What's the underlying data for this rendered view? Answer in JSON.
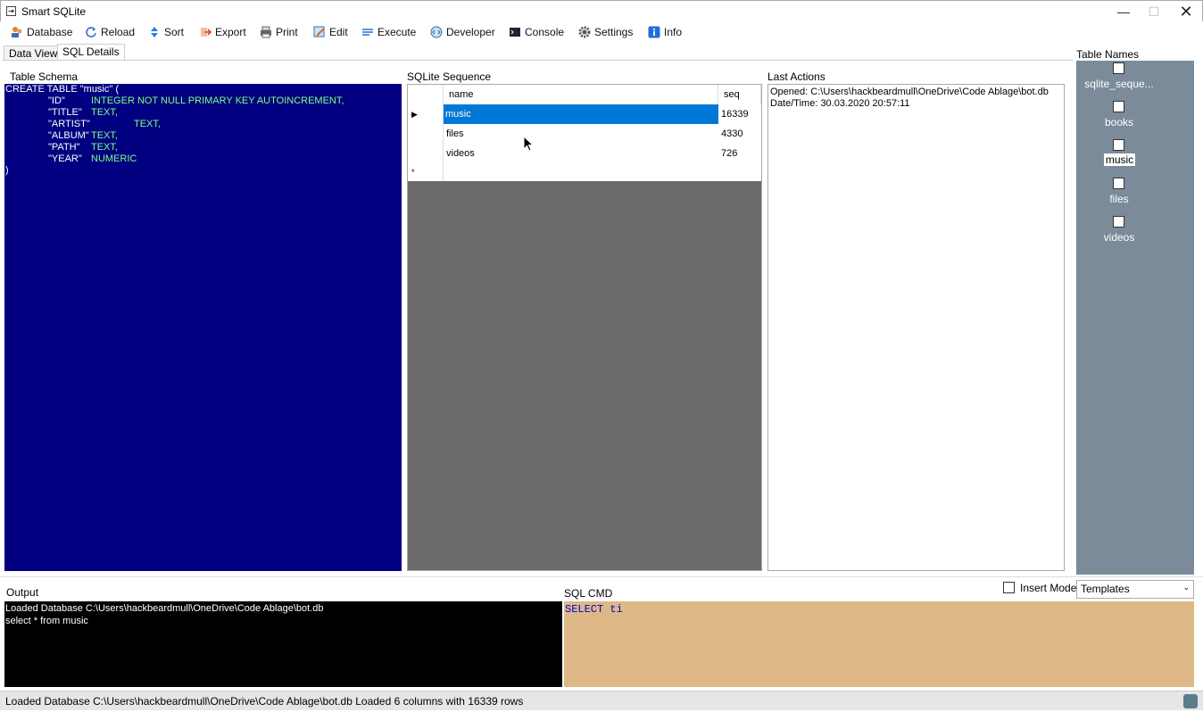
{
  "window": {
    "title": "Smart SQLite",
    "minimize": "—",
    "maximize": "☐",
    "close": "✕"
  },
  "toolbar": {
    "items": [
      {
        "label": "Database",
        "icon": "database-users-icon"
      },
      {
        "label": "Reload",
        "icon": "reload-icon"
      },
      {
        "label": "Sort",
        "icon": "sort-icon"
      },
      {
        "label": "Export",
        "icon": "export-icon"
      },
      {
        "label": "Print",
        "icon": "printer-icon"
      },
      {
        "label": "Edit",
        "icon": "edit-icon"
      },
      {
        "label": "Execute",
        "icon": "execute-icon"
      },
      {
        "label": "Developer",
        "icon": "developer-icon"
      },
      {
        "label": "Console",
        "icon": "console-icon"
      },
      {
        "label": "Settings",
        "icon": "gear-icon"
      },
      {
        "label": "Info",
        "icon": "info-icon"
      }
    ]
  },
  "tabs": {
    "data_view": "Data View",
    "sql_details": "SQL Details",
    "active": "SQL Details"
  },
  "schema": {
    "label": "Table Schema",
    "lines": [
      "CREATE TABLE \"music\" (",
      "\"ID\"",
      "INTEGER NOT NULL PRIMARY KEY AUTOINCREMENT,",
      "\"TITLE\"",
      "TEXT,",
      "\"ARTIST\"",
      "TEXT,",
      "\"ALBUM\"",
      "TEXT,",
      "\"PATH\"",
      "TEXT,",
      "\"YEAR\"",
      "NUMERIC",
      ")"
    ]
  },
  "sequence": {
    "label": "SQLite Sequence",
    "columns": [
      "name",
      "seq"
    ],
    "rows": [
      {
        "name": "music",
        "seq": "16339",
        "marker": "▶"
      },
      {
        "name": "files",
        "seq": "4330",
        "marker": ""
      },
      {
        "name": "videos",
        "seq": "726",
        "marker": ""
      }
    ],
    "new_row_marker": "*"
  },
  "last_actions": {
    "label": "Last Actions",
    "lines": [
      "Opened: C:\\Users\\hackbeardmull\\OneDrive\\Code Ablage\\bot.db",
      "Date/Time: 30.03.2020 20:57:11"
    ]
  },
  "table_names": {
    "label": "Table Names",
    "items": [
      {
        "name": "sqlite_seque...",
        "selected": false
      },
      {
        "name": "books",
        "selected": false
      },
      {
        "name": "music",
        "selected": true
      },
      {
        "name": "files",
        "selected": false
      },
      {
        "name": "videos",
        "selected": false
      }
    ]
  },
  "output": {
    "label": "Output",
    "lines": [
      "Loaded Database C:\\Users\\hackbeardmull\\OneDrive\\Code Ablage\\bot.db",
      "select * from music"
    ]
  },
  "sqlcmd": {
    "label": "SQL CMD",
    "text": "SELECT ti"
  },
  "insert_mode": {
    "label": "Insert Mode"
  },
  "templates": {
    "selected": "Templates",
    "chevron": "⌄"
  },
  "status": {
    "text": "Loaded Database C:\\Users\\hackbeardmull\\OneDrive\\Code Ablage\\bot.db  Loaded 6 columns with 16339 rows"
  },
  "colors": {
    "schema_bg": "#000080",
    "schema_type": "#7fff7f",
    "selection": "#0078d7",
    "grid_bg": "#6b6b6b",
    "tables_panel": "#7b8b99",
    "output_bg": "#000000",
    "sqlcmd_bg": "#deb887",
    "sqlcmd_text": "#0000cc"
  }
}
